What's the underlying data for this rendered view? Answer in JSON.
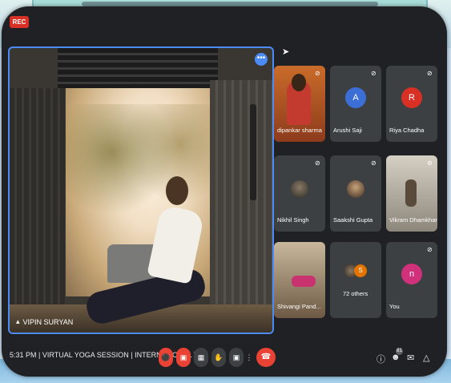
{
  "meeting": {
    "rec_label": "REC",
    "time": "5:31 PM",
    "separator": "|",
    "title": "VIRTUAL YOGA SESSION | INTERNATIONAL Y..."
  },
  "main_video": {
    "speaker_name": "VIPIN SURYAN",
    "more_icon": "•••"
  },
  "participants": [
    {
      "name": "dipankar sharma",
      "type": "video",
      "muted": true
    },
    {
      "name": "Arushi Saji",
      "type": "avatar",
      "initial": "A",
      "color": "#3c6fd6",
      "muted": true
    },
    {
      "name": "Riya Chadha",
      "type": "avatar",
      "initial": "R",
      "color": "#d93025",
      "muted": true
    },
    {
      "name": "Nikhil Singh",
      "type": "photo",
      "muted": true
    },
    {
      "name": "Saakshi Gupta",
      "type": "photo",
      "muted": true
    },
    {
      "name": "Vikram Dhamkhar",
      "type": "video",
      "muted": true
    },
    {
      "name": "Shivangi Pand...",
      "type": "video",
      "muted": false
    },
    {
      "name": "72 others",
      "type": "group",
      "initial": "S",
      "muted": false
    },
    {
      "name": "You",
      "type": "avatar",
      "initial": "n",
      "color": "#d1317a",
      "muted": true
    }
  ],
  "controls": {
    "mic_icon": "mic-off-icon",
    "camera_icon": "camera-off-icon",
    "captions_icon": "captions-icon",
    "raise_hand_icon": "raise-hand-icon",
    "present_icon": "present-icon",
    "more_icon": "more-vert-icon",
    "end_call_icon": "end-call-icon",
    "info_icon": "info-icon",
    "people_icon": "people-icon",
    "chat_icon": "chat-icon",
    "activities_icon": "activities-icon",
    "people_count": "81"
  },
  "colors": {
    "accent": "#4c8bf5",
    "danger": "#ea4335",
    "background": "#202124",
    "tile": "#3c4043"
  }
}
